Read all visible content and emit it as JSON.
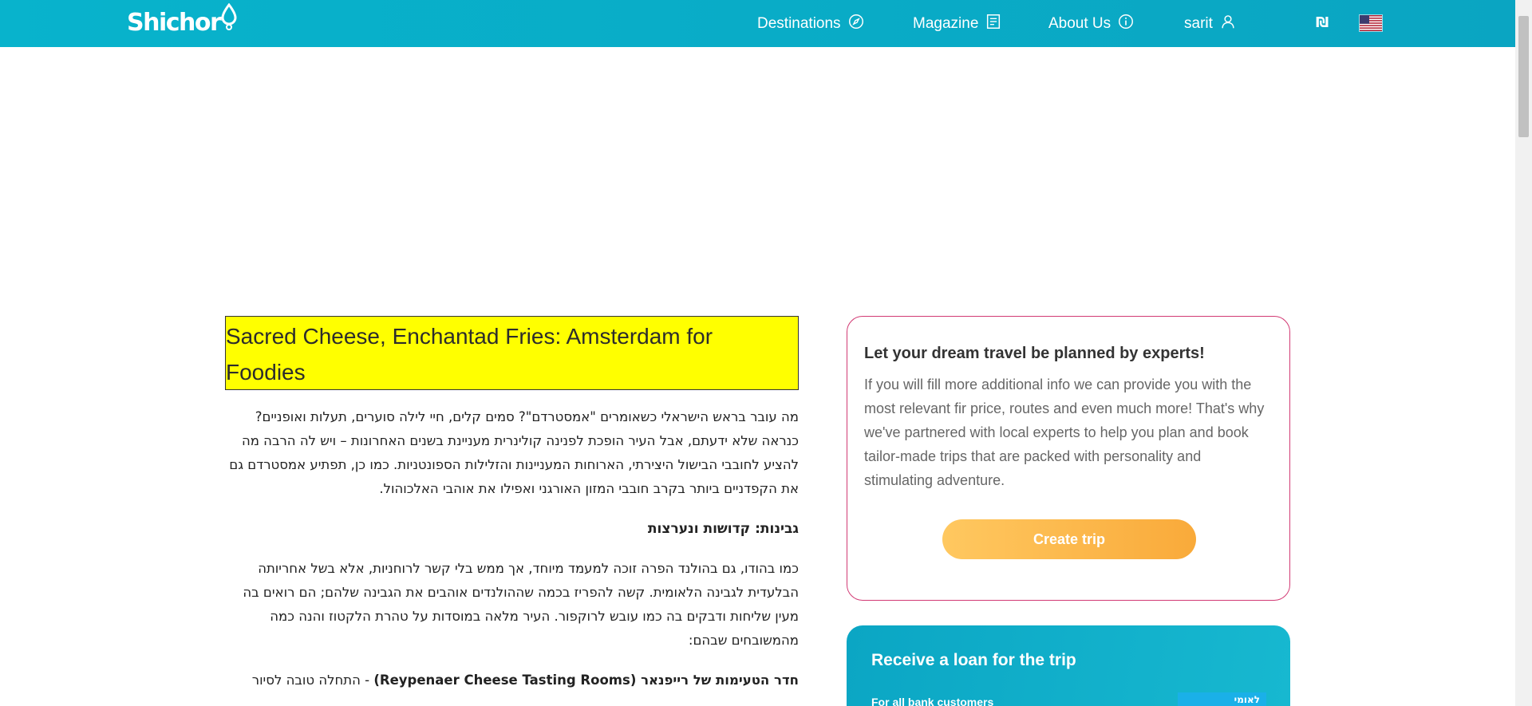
{
  "nav": {
    "logo_text": "Shichor",
    "items": [
      {
        "label": "Destinations",
        "icon": "compass-icon"
      },
      {
        "label": "Magazine",
        "icon": "document-icon"
      },
      {
        "label": "About Us",
        "icon": "info-icon"
      },
      {
        "label": "sarit",
        "icon": "user-icon"
      }
    ],
    "currency_symbol": "₪",
    "language_flag": "us-flag-icon"
  },
  "article": {
    "title": "Sacred Cheese, Enchantad Fries: Amsterdam for Foodies",
    "intro": "מה עובר בראש הישראלי כשאומרים \"אמסטרדם\"? סמים קלים, חיי לילה סוערים, תעלות ואופניים? כנראה שלא ידעתם, אבל העיר הופכת לפנינה קולינרית מעניינת בשנים האחרונות – ויש לה הרבה מה להציע לחובבי הבישול היצירתי, הארוחות המעניינות והזלילות הספונטניות. כמו כן, תפתיע אמסטרדם גם את הקפדניים ביותר בקרב חובבי המזון האורגני ואפילו את אוהבי האלכוהול.",
    "section_heading": "גבינות: קדושות ונערצות",
    "section_text": "כמו בהודו, גם בהולנד הפרה זוכה למעמד מיוחד, אך ממש בלי קשר לרוחניות, אלא בשל אחריותה הבלעדית לגבינה הלאומית. קשה להפריז בכמה שההולנדים אוהבים את הגבינה שלהם; הם רואים בה מעין שליחות ודבקים בה כמו עובש לרוקפור. העיר מלאה במוסדות על טהרת הלקטוז והנה כמה מהמשובחים שבהם:",
    "next_bold": "חדר הטעימות של רייפנאר (Reypenaer Cheese Tasting Rooms)",
    "next_text": " - התחלה טובה לסיור"
  },
  "expert_card": {
    "title": "Let your dream travel be planned by experts!",
    "text": "If you will fill more additional info we can provide you with the most relevant fir price, routes and even much more! That's why we've partnered with local experts to help you plan and book tailor-made trips that are packed with personality and stimulating adventure.",
    "button_label": "Create trip"
  },
  "loan_card": {
    "title": "Receive a loan for the trip",
    "subtitle": "For all bank customers",
    "bank_label": "לאומי"
  },
  "colors": {
    "nav_bg": "#0aaec8",
    "title_highlight": "#ffff00",
    "card_border": "#d23a74",
    "button": "#fbb84c"
  }
}
